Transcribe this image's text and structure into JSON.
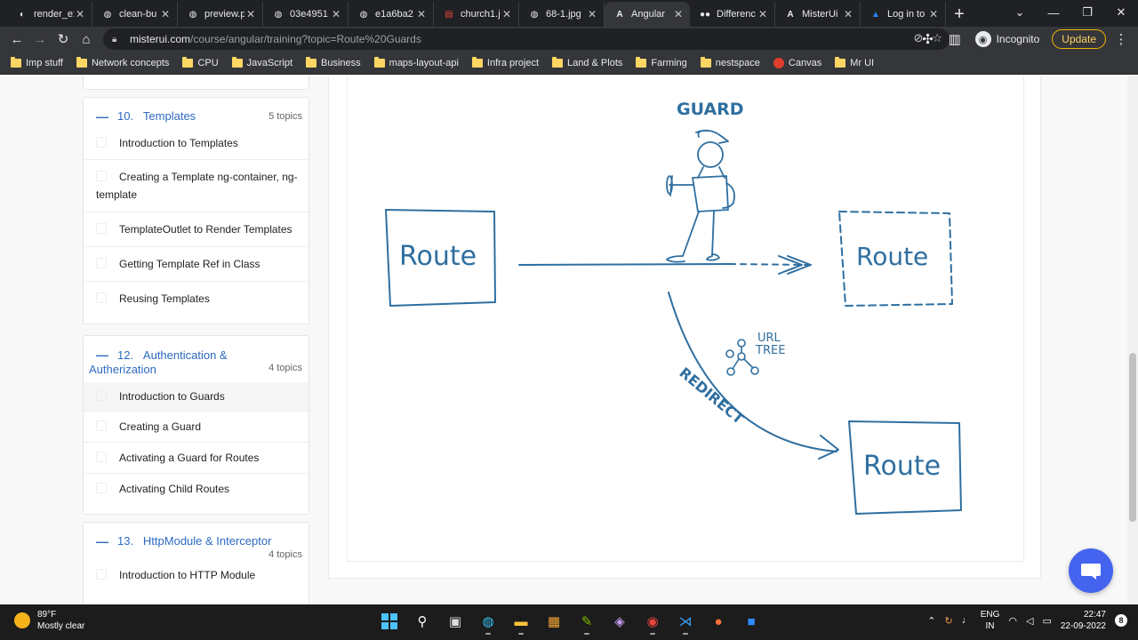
{
  "browser": {
    "tabs": [
      {
        "title": "render_ex",
        "icon": "profile-icon"
      },
      {
        "title": "clean-bu",
        "icon": "globe-icon"
      },
      {
        "title": "preview.p",
        "icon": "globe-icon"
      },
      {
        "title": "03e4951",
        "icon": "globe-icon"
      },
      {
        "title": "e1a6ba2",
        "icon": "globe-icon"
      },
      {
        "title": "church1.j",
        "icon": "image-icon"
      },
      {
        "title": "68-1.jpg",
        "icon": "globe-icon"
      },
      {
        "title": "Angular",
        "icon": "angular-icon",
        "active": true
      },
      {
        "title": "Differenc",
        "icon": "medium-icon"
      },
      {
        "title": "MisterUi",
        "icon": "angular-icon"
      },
      {
        "title": "Log in to",
        "icon": "atlassian-icon"
      }
    ],
    "url_host": "misterui.com",
    "url_path": "/course/angular/training?topic=Route%20Guards",
    "profile_label": "Incognito",
    "update_label": "Update",
    "bookmarks": [
      "Imp stuff",
      "Network concepts",
      "CPU",
      "JavaScript",
      "Business",
      "maps-layout-api",
      "Infra project",
      "Land & Plots",
      "Farming",
      "nestspace",
      "Canvas",
      "Mr UI"
    ]
  },
  "sidebar": {
    "chapters": [
      {
        "number": "10.",
        "title": "Templates",
        "count": "5 topics",
        "lessons": [
          "Introduction to Templates",
          "Creating a Template ng-container, ng-template",
          "TemplateOutlet to Render Templates",
          "Getting Template Ref in Class",
          "Reusing Templates"
        ]
      },
      {
        "number": "12.",
        "title": "Authentication & Autherization",
        "count": "4 topics",
        "lessons": [
          "Introduction to Guards",
          "Creating a Guard",
          "Activating a Guard for Routes",
          "Activating Child Routes"
        ]
      },
      {
        "number": "13.",
        "title": "HttpModule & Interceptor",
        "count": "4 topics",
        "lessons": [
          "Introduction to HTTP Module"
        ]
      }
    ]
  },
  "diagram": {
    "guard_label": "GUARD",
    "route_left": "Route",
    "route_right": "Route",
    "route_bottom": "Route",
    "url_tree_line1": "URL",
    "url_tree_line2": "TREE",
    "redirect_label": "REDIRECT",
    "stroke_color": "#2f6fa0"
  },
  "taskbar": {
    "temperature": "89°F",
    "weather": "Mostly clear",
    "lang_line1": "ENG",
    "lang_line2": "IN",
    "time": "22:47",
    "date": "22-09-2022",
    "notification_count": "8"
  }
}
